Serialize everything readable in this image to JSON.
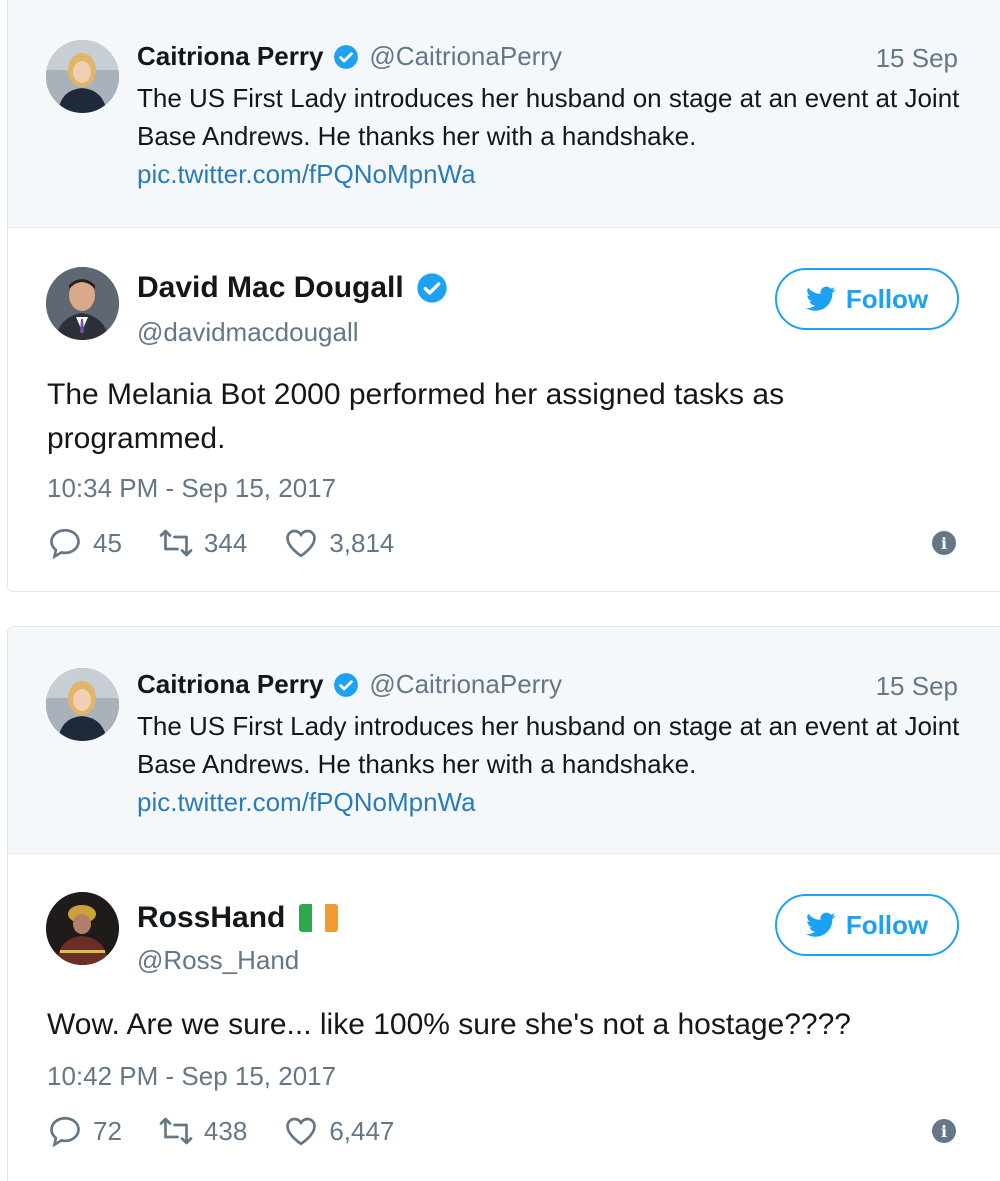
{
  "tweets": [
    {
      "quoted": {
        "name": "Caitriona Perry",
        "handle": "@CaitrionaPerry",
        "date": "15 Sep",
        "text": "The US First Lady introduces her husband on stage at an event at Joint Base Andrews. He thanks her with a handshake.",
        "link": "pic.twitter.com/fPQNoMpnWa"
      },
      "author": {
        "name": "David Mac Dougall",
        "handle": "@davidmacdougall"
      },
      "follow_label": "Follow",
      "text": "The Melania Bot 2000 performed her assigned tasks as programmed.",
      "timestamp": "10:34 PM - Sep 15, 2017",
      "replies": "45",
      "retweets": "344",
      "likes": "3,814"
    },
    {
      "quoted": {
        "name": "Caitriona Perry",
        "handle": "@CaitrionaPerry",
        "date": "15 Sep",
        "text": "The US First Lady introduces her husband on stage at an event at Joint Base Andrews. He thanks her with a handshake.",
        "link": "pic.twitter.com/fPQNoMpnWa"
      },
      "author": {
        "name": "RossHand",
        "handle": "@Ross_Hand"
      },
      "follow_label": "Follow",
      "text": "Wow. Are we sure... like 100% sure she's not a hostage????",
      "timestamp": "10:42 PM - Sep 15, 2017",
      "replies": "72",
      "retweets": "438",
      "likes": "6,447"
    }
  ],
  "colors": {
    "accent": "#1da1f2",
    "link": "#2b7bb9",
    "muted": "#657786",
    "quote_bg": "#f5f8fa"
  }
}
